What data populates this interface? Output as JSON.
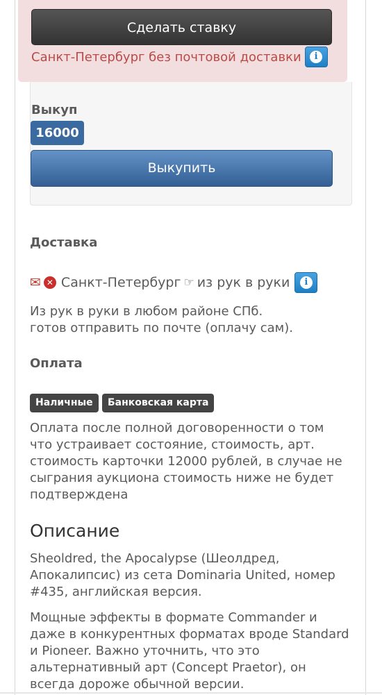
{
  "bid": {
    "button_label": "Сделать ставку",
    "notice": "Санкт-Петербург без почтовой доставки"
  },
  "buyout": {
    "label": "Выкуп",
    "price": "16000",
    "button_label": "Выкупить"
  },
  "delivery": {
    "heading": "Доставка",
    "city": "Санкт-Петербург",
    "method": "из рук в руки",
    "note_lines": [
      "Из рук в руки в любом районе СПб.",
      "готов отправить по почте (оплачу сам)."
    ]
  },
  "payment": {
    "heading": "Оплата",
    "methods": [
      "Наличные",
      "Банковская карта"
    ],
    "note_lines": [
      "Оплата после полной договоренности о том",
      "что устраивает состояние, стоимость, арт.",
      "стоимость карточки 12000 рублей, в случае не",
      "сыграния аукциона стоимость ниже не будет",
      "подтверждена"
    ]
  },
  "description": {
    "heading": "Описание",
    "para1_lines": [
      "Sheoldred, the Apocalypse (Шеолдред,",
      "Апокалипсис) из сета Dominaria United, номер",
      "#435, английская версия."
    ],
    "para2_lines": [
      "Мощные эффекты в формате Commander и",
      "даже в конкурентных форматах вроде Standard",
      "и Pioneer. Важно уточнить, что это",
      "альтернативный арт (Concept Praetor), он",
      "всегда дороже обычной версии."
    ]
  },
  "icons": {
    "info": "info-icon",
    "envelope": "envelope-icon",
    "no_post": "close-circle-icon",
    "hand": "hand-pointing-icon"
  }
}
